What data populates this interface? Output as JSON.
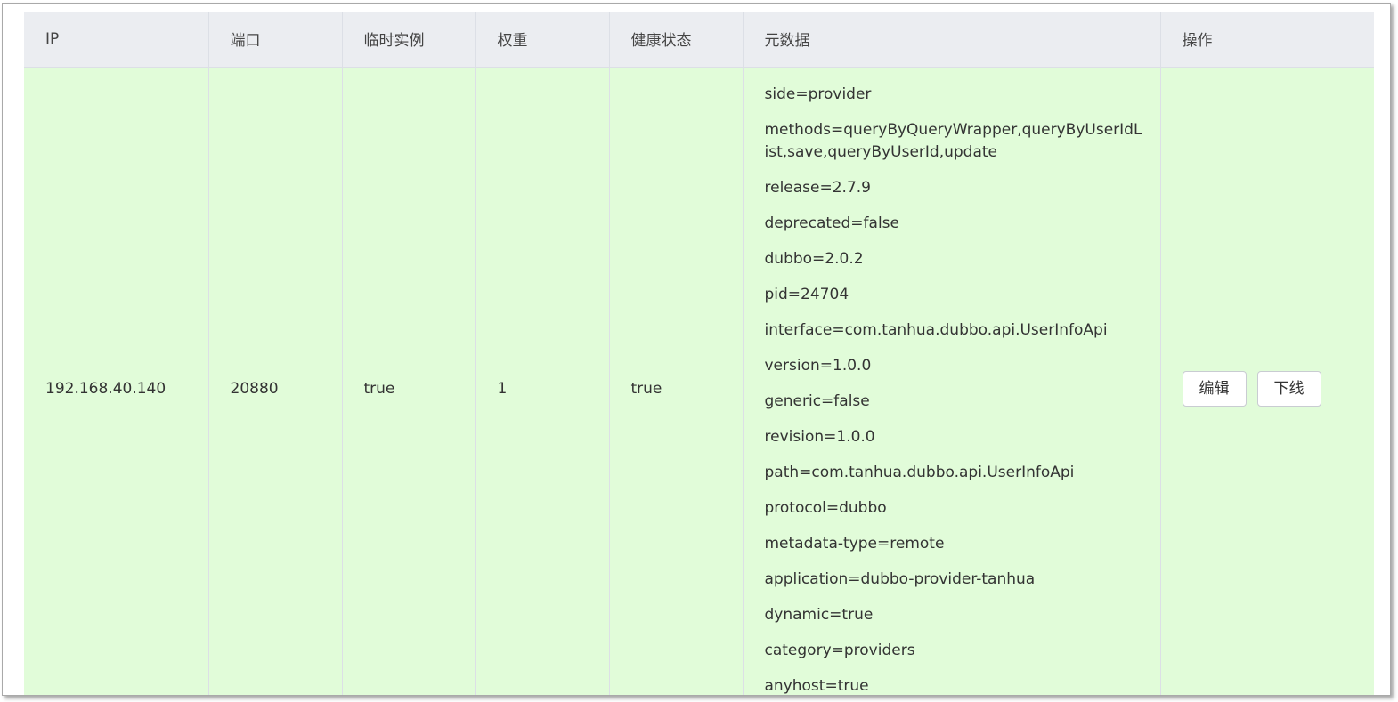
{
  "table": {
    "headers": [
      "IP",
      "端口",
      "临时实例",
      "权重",
      "健康状态",
      "元数据",
      "操作"
    ],
    "rows": [
      {
        "ip": "192.168.40.140",
        "port": "20880",
        "ephemeral": "true",
        "weight": "1",
        "healthy": "true",
        "metadata": [
          "side=provider",
          "methods=queryByQueryWrapper,queryByUserIdList,save,queryByUserId,update",
          "release=2.7.9",
          "deprecated=false",
          "dubbo=2.0.2",
          "pid=24704",
          "interface=com.tanhua.dubbo.api.UserInfoApi",
          "version=1.0.0",
          "generic=false",
          "revision=1.0.0",
          "path=com.tanhua.dubbo.api.UserInfoApi",
          "protocol=dubbo",
          "metadata-type=remote",
          "application=dubbo-provider-tanhua",
          "dynamic=true",
          "category=providers",
          "anyhost=true"
        ],
        "actions": {
          "edit_label": "编辑",
          "offline_label": "下线"
        }
      }
    ]
  }
}
